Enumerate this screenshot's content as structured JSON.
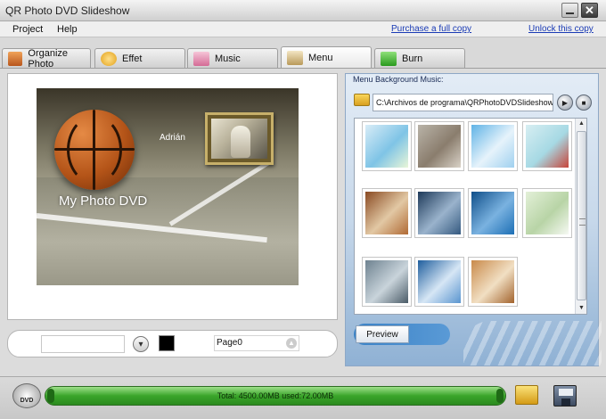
{
  "window": {
    "title": "QR Photo DVD Slideshow"
  },
  "menubar": {
    "items": [
      "Project",
      "Help"
    ],
    "links": {
      "purchase": "Purchase a full copy",
      "unlock": "Unlock this copy"
    }
  },
  "tabs": [
    {
      "label": "Organize Photo",
      "icon": "organize-photo-icon",
      "active": false
    },
    {
      "label": "Effet",
      "icon": "effect-icon",
      "active": false
    },
    {
      "label": "Music",
      "icon": "music-note-icon",
      "active": false
    },
    {
      "label": "Menu",
      "icon": "menu-icon",
      "active": true
    },
    {
      "label": "Burn",
      "icon": "burn-disc-icon",
      "active": false
    }
  ],
  "preview": {
    "name_text": "Adrián",
    "title_text": "My Photo DVD"
  },
  "bottom_controls": {
    "text_value": "",
    "color": "#000000",
    "page_value": "Page0"
  },
  "side_panel": {
    "title": "Menu Background Music:",
    "path_value": "C:\\Archivos de programa\\QRPhotoDVDSlideshow\\mu",
    "preview_label": "Preview"
  },
  "templates": [
    {
      "colors": [
        "#d8ecf7",
        "#7fc4e6",
        "#e9f6d8"
      ]
    },
    {
      "colors": [
        "#b9b3a8",
        "#8a7d6d",
        "#d9d2c7"
      ]
    },
    {
      "colors": [
        "#5fb3e6",
        "#e6f3fb",
        "#9fd0ef"
      ]
    },
    {
      "colors": [
        "#d7eef2",
        "#a6d9e4",
        "#c8453a"
      ]
    },
    {
      "colors": [
        "#8a4a22",
        "#e2c8a4",
        "#b06a34"
      ]
    },
    {
      "colors": [
        "#1e3a5a",
        "#9ab3cc",
        "#355a80"
      ]
    },
    {
      "colors": [
        "#0f4f8a",
        "#7ab2e0",
        "#1d6fb5"
      ]
    },
    {
      "colors": [
        "#e3f0d8",
        "#b8d4a6",
        "#f6f9f3"
      ]
    },
    {
      "colors": [
        "#6e8290",
        "#c9d4db",
        "#4a5b67"
      ]
    },
    {
      "colors": [
        "#1f5e9e",
        "#d6e6f5",
        "#5a95cf"
      ]
    },
    {
      "colors": [
        "#c98a4a",
        "#f1dfc3",
        "#a2632c"
      ]
    }
  ],
  "status": {
    "progress_text": "Total: 4500.00MB used:72.00MB",
    "total_mb": 4500.0,
    "used_mb": 72.0,
    "dvd_label": "DVD"
  }
}
